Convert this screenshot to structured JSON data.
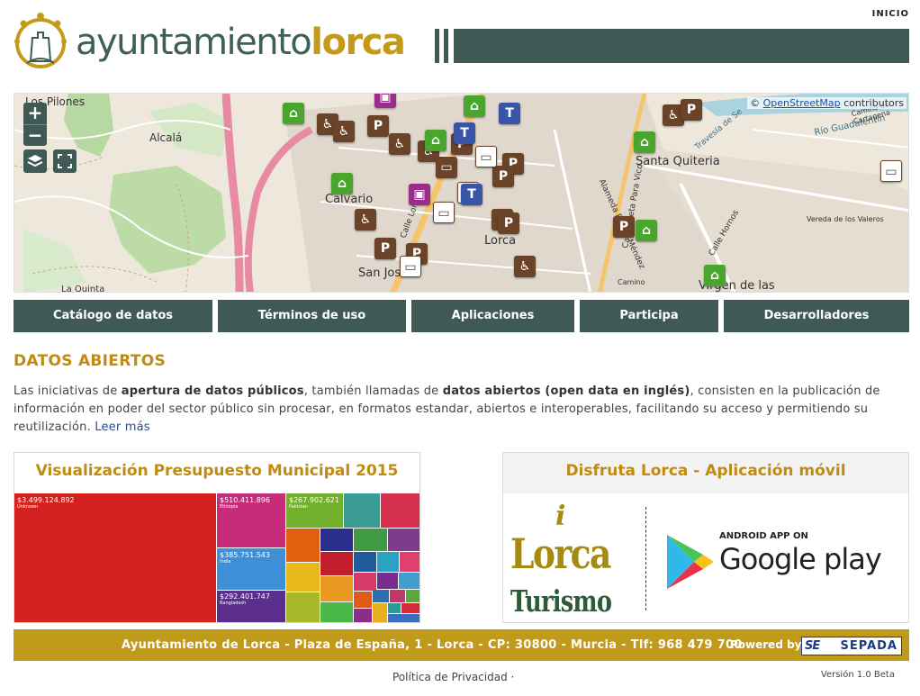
{
  "header": {
    "top_link": "INICIO",
    "logo_word1": "ayuntamiento",
    "logo_word2": "lorca"
  },
  "map": {
    "attribution_prefix": "©",
    "attribution_link": "OpenStreetMap",
    "attribution_suffix": "contributors",
    "zoom_in": "+",
    "zoom_out": "−",
    "labels": [
      "Los Pilones",
      "Alcalá",
      "Calvario",
      "San José",
      "La Quinta",
      "Santa Quiteria",
      "Río Guadalentín",
      "Virgen de las",
      "Travesía de Se",
      "Calle Lorca",
      "Alameda Rafael Méndez",
      "Calle Hornos",
      "Calle Poeta Para Vico",
      "Lorca",
      "Camino de Cartagena",
      "Vereda de los Valeros",
      "Camino"
    ]
  },
  "nav": {
    "items": [
      "Catálogo de datos",
      "Términos de uso",
      "Aplicaciones",
      "Participa",
      "Desarrolladores"
    ]
  },
  "intro": {
    "title": "DATOS ABIERTOS",
    "t1": "Las iniciativas de ",
    "b1": "apertura de datos públicos",
    "t2": ", también llamadas de ",
    "b2": "datos abiertos (open data en inglés)",
    "t3": ", consisten en la publicación de información en poder del sector público sin procesar, en formatos estandar, abiertos e interoperables, facilitando su acceso y permitiendo su reutilización. ",
    "link": "Leer más"
  },
  "cards": {
    "budget_title": "Visualización Presupuesto Municipal 2015",
    "treemap": [
      {
        "value": "$3.499.124.892",
        "label": "Unknown"
      },
      {
        "value": "$510.411.896",
        "label": "Ethiopia"
      },
      {
        "value": "$267.902.621",
        "label": "Pakistan"
      },
      {
        "value": "$385.751.543",
        "label": "India"
      },
      {
        "value": "$292.401.747",
        "label": "Bangladesh"
      }
    ],
    "app_title": "Disfruta Lorca - Aplicación móvil",
    "lorca_i": "i",
    "lorca_word": "Lorca",
    "lorca_sub": "Turismo",
    "gp_top": "ANDROID APP ON",
    "gp_main": "Google play"
  },
  "footer": {
    "address": "Ayuntamiento de Lorca - Plaza de España, 1 - Lorca - CP: 30800 - Murcia - Tlf: 968 479 700",
    "powered": "Powered by",
    "sepada": "SEPADA",
    "sepada_mark": "SE",
    "privacy": "Política de Privacidad ·",
    "version": "Versión 1.0 Beta"
  },
  "colors": {
    "primary": "#3f5a55",
    "accent": "#c08b10",
    "footer": "#c09a1a"
  }
}
